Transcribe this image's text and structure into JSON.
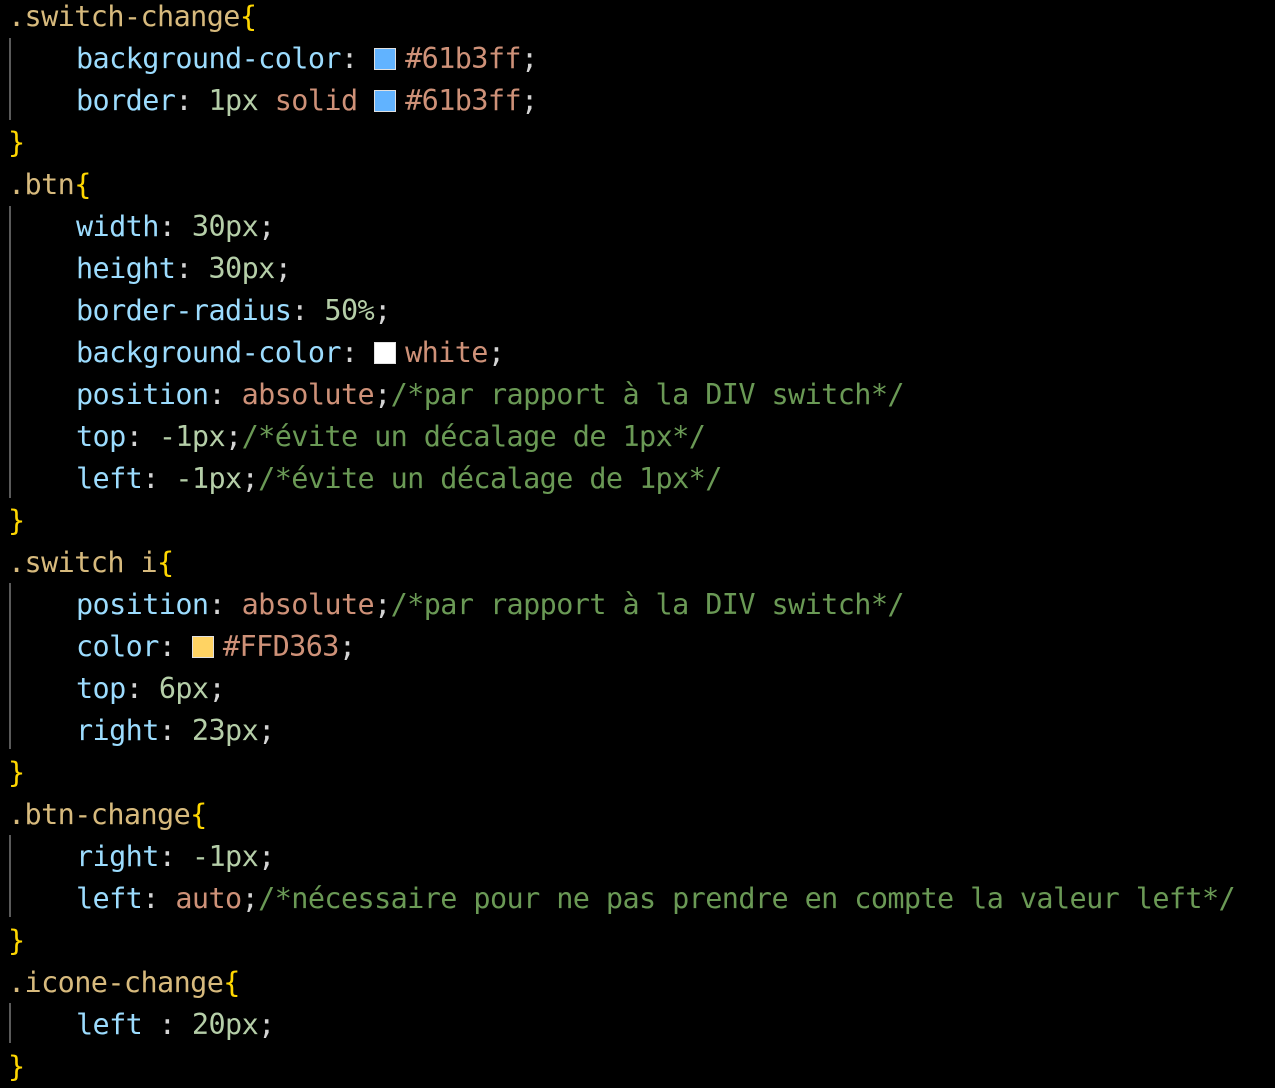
{
  "code": {
    "switch_change": {
      "selector": ".switch-change",
      "open": "{",
      "close": "}",
      "lines": [
        {
          "prop": "background-color",
          "sep": ": ",
          "color": "#61b3ff",
          "value": "#61b3ff",
          "end": ";"
        },
        {
          "prop": "border",
          "sep": ": ",
          "value1": "1px",
          "value2": "solid",
          "color": "#61b3ff",
          "value": "#61b3ff",
          "end": ";"
        }
      ]
    },
    "btn": {
      "selector": ".btn",
      "open": "{",
      "close": "}",
      "lines": [
        {
          "prop": "width",
          "sep": ": ",
          "value": "30px",
          "end": ";"
        },
        {
          "prop": "height",
          "sep": ": ",
          "value": "30px",
          "end": ";"
        },
        {
          "prop": "border-radius",
          "sep": ": ",
          "value": "50%",
          "end": ";"
        },
        {
          "prop": "background-color",
          "sep": ": ",
          "color": "#ffffff",
          "value": "white",
          "end": ";"
        },
        {
          "prop": "position",
          "sep": ": ",
          "value": "absolute",
          "end": ";",
          "comment": "/*par rapport à la DIV switch*/"
        },
        {
          "prop": "top",
          "sep": ": ",
          "value": "-1px",
          "end": ";",
          "comment": "/*évite un décalage de 1px*/"
        },
        {
          "prop": "left",
          "sep": ": ",
          "value": "-1px",
          "end": ";",
          "comment": "/*évite un décalage de 1px*/"
        }
      ]
    },
    "switch_i": {
      "selector": ".switch i",
      "open": "{",
      "close": "}",
      "lines": [
        {
          "prop": "position",
          "sep": ": ",
          "value": "absolute",
          "end": ";",
          "comment": "/*par rapport à la DIV switch*/"
        },
        {
          "prop": "color",
          "sep": ": ",
          "color": "#FFD363",
          "value": "#FFD363",
          "end": ";"
        },
        {
          "prop": "top",
          "sep": ": ",
          "value": "6px",
          "end": ";"
        },
        {
          "prop": "right",
          "sep": ": ",
          "value": "23px",
          "end": ";"
        }
      ]
    },
    "btn_change": {
      "selector": ".btn-change",
      "open": "{",
      "close": "}",
      "lines": [
        {
          "prop": "right",
          "sep": ": ",
          "value": "-1px",
          "end": ";"
        },
        {
          "prop": "left",
          "sep": ": ",
          "value": "auto",
          "end": ";",
          "comment": "/*nécessaire pour ne pas prendre en compte la valeur left*/"
        }
      ]
    },
    "icone_change": {
      "selector": ".icone-change",
      "open": "{",
      "close": "}",
      "lines": [
        {
          "prop": "left",
          "sep": " : ",
          "value": "20px",
          "end": ";"
        }
      ]
    }
  }
}
